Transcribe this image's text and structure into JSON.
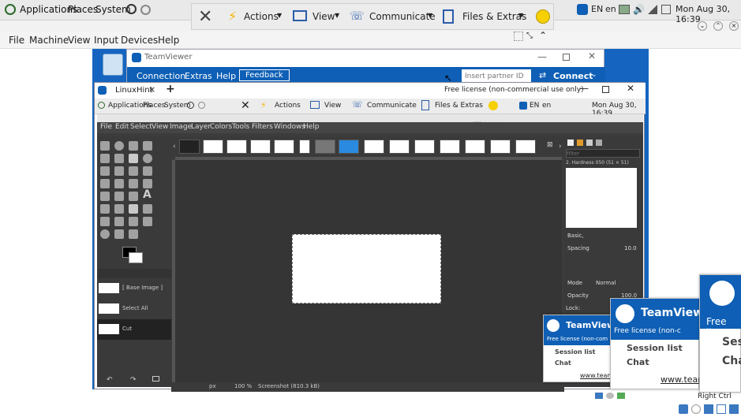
{
  "host_panel": {
    "applications": "Applications",
    "places": "Places",
    "system": "System",
    "kbd": "EN",
    "lang": "en",
    "clock": "Mon Aug 30, 16:39"
  },
  "tv_toolbar": {
    "actions": "Actions",
    "view": "View",
    "communicate": "Communicate",
    "files_extras": "Files & Extras"
  },
  "vb_menu": [
    "File",
    "Machine",
    "View",
    "Input",
    "Devices",
    "Help"
  ],
  "tv_main": {
    "title": "TeamViewer",
    "menu": [
      "Connection",
      "Extras",
      "Help"
    ],
    "feedback": "Feedback",
    "partner_placeholder": "Insert partner ID",
    "connect": "Connect"
  },
  "session": {
    "tab_label": "LinuxHint",
    "license": "Free license (non-commercial use only)"
  },
  "inner_panel": {
    "applications": "Applications",
    "places": "Places",
    "system": "System",
    "actions": "Actions",
    "view": "View",
    "communicate": "Communicate",
    "files_extras": "Files & Extras",
    "kbd": "EN",
    "lang": "en",
    "clock": "Mon Aug 30, 16:39"
  },
  "gimp": {
    "menu": [
      "File",
      "Edit",
      "Select",
      "View",
      "Image",
      "Layer",
      "Colors",
      "Tools",
      "Filters",
      "Windows",
      "Help"
    ],
    "history": [
      "[ Base Image ]",
      "Select All",
      "Cut"
    ],
    "brush_filter": "filter",
    "brush_name": "2. Hardness 050 (51 × 51)",
    "brush_set": "Basic,",
    "spacing_label": "Spacing",
    "spacing_value": "10.0",
    "mode_label": "Mode",
    "mode_value": "Normal",
    "opacity_label": "Opacity",
    "opacity_value": "100.0",
    "lock_label": "Lock:",
    "unit": "px",
    "zoom": "100 %",
    "status": "Screenshot (810.3 kB)"
  },
  "popups": {
    "brand": "TeamViewer",
    "brand_cut": "TeamView",
    "brand_cut2": "TeamViewe",
    "license_short": "Free license (non-com",
    "license_short2": "Free license (non-c",
    "license_short3": "Free lice",
    "session_list": "Session list",
    "session_cut": "Ses",
    "chat": "Chat",
    "chat_cut": "Cha",
    "link": "www.team",
    "link2": "www.team"
  },
  "tray": {
    "right_ctrl": "Right Ctrl"
  },
  "colors": {
    "tv_blue": "#0e5fb5",
    "gimp_bg": "#3c3c3c"
  }
}
